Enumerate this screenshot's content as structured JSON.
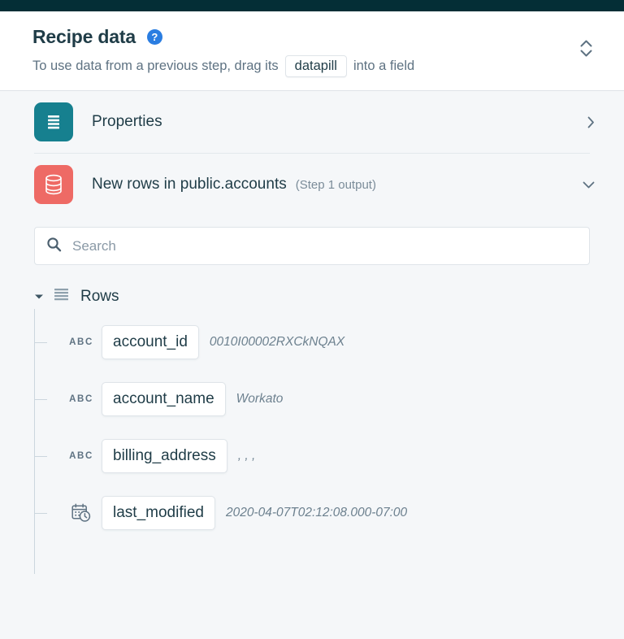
{
  "topbar": {
    "color": "#042e36"
  },
  "header": {
    "title": "Recipe data",
    "help_icon": "question-circle-icon",
    "subtitle_before": "To use data from a previous step, drag its",
    "subtitle_pill": "datapill",
    "subtitle_after": "into a field",
    "collapse_icon": "chevron-up-down-icon"
  },
  "sections": [
    {
      "icon": "list-lines-icon",
      "icon_color": "#16808f",
      "label": "Properties",
      "sub": "",
      "chevron": "chevron-right-icon",
      "expanded": false
    },
    {
      "icon": "database-icon",
      "icon_color": "#ee6a65",
      "label": "New rows in public.accounts",
      "sub": "(Step 1 output)",
      "chevron": "chevron-down-icon",
      "expanded": true
    }
  ],
  "search": {
    "icon": "search-icon",
    "placeholder": "Search",
    "value": ""
  },
  "tree": {
    "caret_icon": "caret-down-icon",
    "group_icon": "list-lines-icon",
    "group_label": "Rows",
    "fields": [
      {
        "type_icon": "abc-text-icon",
        "type_label": "ABC",
        "name": "account_id",
        "sample": "0010I00002RXCkNQAX"
      },
      {
        "type_icon": "abc-text-icon",
        "type_label": "ABC",
        "name": "account_name",
        "sample": "Workato"
      },
      {
        "type_icon": "abc-text-icon",
        "type_label": "ABC",
        "name": "billing_address",
        "sample": ", , ,"
      },
      {
        "type_icon": "calendar-clock-icon",
        "type_label": "",
        "name": "last_modified",
        "sample": "2020-04-07T02:12:08.000-07:00"
      }
    ]
  }
}
